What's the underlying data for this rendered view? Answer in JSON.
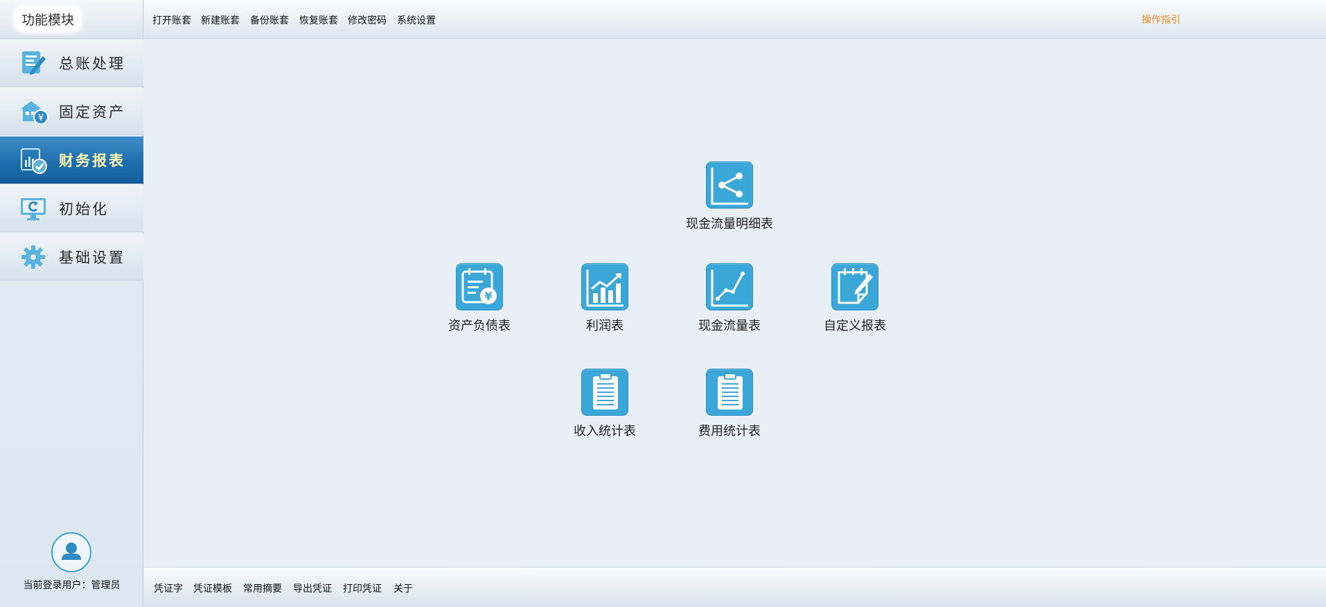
{
  "sidebar": {
    "title": "功能模块",
    "items": [
      {
        "label": "总账处理",
        "icon": "ledger-edit-icon"
      },
      {
        "label": "固定资产",
        "icon": "fixed-asset-icon"
      },
      {
        "label": "财务报表",
        "icon": "report-chart-icon",
        "active": true
      },
      {
        "label": "初始化",
        "icon": "monitor-refresh-icon"
      },
      {
        "label": "基础设置",
        "icon": "gear-icon"
      }
    ],
    "user": {
      "label": "当前登录用户：管理员",
      "icon": "user-avatar-icon"
    }
  },
  "toolbar": {
    "items": [
      "打开账套",
      "新建账套",
      "备份账套",
      "恢复账套",
      "修改密码",
      "系统设置"
    ],
    "help": "操作指引"
  },
  "reports": {
    "cashflow_detail": {
      "label": "现金流量明细表",
      "icon": "share-chart-icon"
    },
    "balance_sheet": {
      "label": "资产负债表",
      "icon": "calendar-yen-icon"
    },
    "profit": {
      "label": "利润表",
      "icon": "bar-trend-icon"
    },
    "cashflow": {
      "label": "现金流量表",
      "icon": "line-chart-icon"
    },
    "custom": {
      "label": "自定义报表",
      "icon": "note-edit-icon"
    },
    "income_stats": {
      "label": "收入统计表",
      "icon": "clipboard-icon"
    },
    "expense_stats": {
      "label": "费用统计表",
      "icon": "clipboard-icon"
    }
  },
  "bottombar": {
    "items": [
      "凭证字",
      "凭证模板",
      "常用摘要",
      "导出凭证",
      "打印凭证",
      "关于"
    ]
  },
  "colors": {
    "accent": "#3aa7d8",
    "active_nav": "#1f6fae",
    "help": "#f08a1c",
    "active_label": "#fff8b0"
  }
}
